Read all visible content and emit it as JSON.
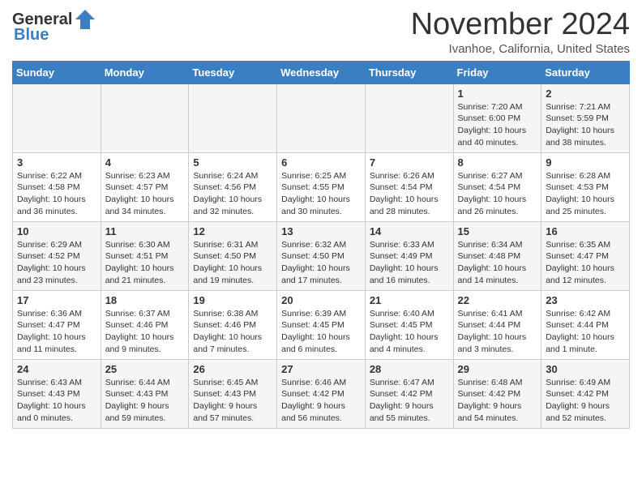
{
  "header": {
    "logo_general": "General",
    "logo_blue": "Blue",
    "month_title": "November 2024",
    "location": "Ivanhoe, California, United States"
  },
  "days_of_week": [
    "Sunday",
    "Monday",
    "Tuesday",
    "Wednesday",
    "Thursday",
    "Friday",
    "Saturday"
  ],
  "weeks": [
    [
      {
        "day": "",
        "detail": ""
      },
      {
        "day": "",
        "detail": ""
      },
      {
        "day": "",
        "detail": ""
      },
      {
        "day": "",
        "detail": ""
      },
      {
        "day": "",
        "detail": ""
      },
      {
        "day": "1",
        "detail": "Sunrise: 7:20 AM\nSunset: 6:00 PM\nDaylight: 10 hours\nand 40 minutes."
      },
      {
        "day": "2",
        "detail": "Sunrise: 7:21 AM\nSunset: 5:59 PM\nDaylight: 10 hours\nand 38 minutes."
      }
    ],
    [
      {
        "day": "3",
        "detail": "Sunrise: 6:22 AM\nSunset: 4:58 PM\nDaylight: 10 hours\nand 36 minutes."
      },
      {
        "day": "4",
        "detail": "Sunrise: 6:23 AM\nSunset: 4:57 PM\nDaylight: 10 hours\nand 34 minutes."
      },
      {
        "day": "5",
        "detail": "Sunrise: 6:24 AM\nSunset: 4:56 PM\nDaylight: 10 hours\nand 32 minutes."
      },
      {
        "day": "6",
        "detail": "Sunrise: 6:25 AM\nSunset: 4:55 PM\nDaylight: 10 hours\nand 30 minutes."
      },
      {
        "day": "7",
        "detail": "Sunrise: 6:26 AM\nSunset: 4:54 PM\nDaylight: 10 hours\nand 28 minutes."
      },
      {
        "day": "8",
        "detail": "Sunrise: 6:27 AM\nSunset: 4:54 PM\nDaylight: 10 hours\nand 26 minutes."
      },
      {
        "day": "9",
        "detail": "Sunrise: 6:28 AM\nSunset: 4:53 PM\nDaylight: 10 hours\nand 25 minutes."
      }
    ],
    [
      {
        "day": "10",
        "detail": "Sunrise: 6:29 AM\nSunset: 4:52 PM\nDaylight: 10 hours\nand 23 minutes."
      },
      {
        "day": "11",
        "detail": "Sunrise: 6:30 AM\nSunset: 4:51 PM\nDaylight: 10 hours\nand 21 minutes."
      },
      {
        "day": "12",
        "detail": "Sunrise: 6:31 AM\nSunset: 4:50 PM\nDaylight: 10 hours\nand 19 minutes."
      },
      {
        "day": "13",
        "detail": "Sunrise: 6:32 AM\nSunset: 4:50 PM\nDaylight: 10 hours\nand 17 minutes."
      },
      {
        "day": "14",
        "detail": "Sunrise: 6:33 AM\nSunset: 4:49 PM\nDaylight: 10 hours\nand 16 minutes."
      },
      {
        "day": "15",
        "detail": "Sunrise: 6:34 AM\nSunset: 4:48 PM\nDaylight: 10 hours\nand 14 minutes."
      },
      {
        "day": "16",
        "detail": "Sunrise: 6:35 AM\nSunset: 4:47 PM\nDaylight: 10 hours\nand 12 minutes."
      }
    ],
    [
      {
        "day": "17",
        "detail": "Sunrise: 6:36 AM\nSunset: 4:47 PM\nDaylight: 10 hours\nand 11 minutes."
      },
      {
        "day": "18",
        "detail": "Sunrise: 6:37 AM\nSunset: 4:46 PM\nDaylight: 10 hours\nand 9 minutes."
      },
      {
        "day": "19",
        "detail": "Sunrise: 6:38 AM\nSunset: 4:46 PM\nDaylight: 10 hours\nand 7 minutes."
      },
      {
        "day": "20",
        "detail": "Sunrise: 6:39 AM\nSunset: 4:45 PM\nDaylight: 10 hours\nand 6 minutes."
      },
      {
        "day": "21",
        "detail": "Sunrise: 6:40 AM\nSunset: 4:45 PM\nDaylight: 10 hours\nand 4 minutes."
      },
      {
        "day": "22",
        "detail": "Sunrise: 6:41 AM\nSunset: 4:44 PM\nDaylight: 10 hours\nand 3 minutes."
      },
      {
        "day": "23",
        "detail": "Sunrise: 6:42 AM\nSunset: 4:44 PM\nDaylight: 10 hours\nand 1 minute."
      }
    ],
    [
      {
        "day": "24",
        "detail": "Sunrise: 6:43 AM\nSunset: 4:43 PM\nDaylight: 10 hours\nand 0 minutes."
      },
      {
        "day": "25",
        "detail": "Sunrise: 6:44 AM\nSunset: 4:43 PM\nDaylight: 9 hours\nand 59 minutes."
      },
      {
        "day": "26",
        "detail": "Sunrise: 6:45 AM\nSunset: 4:43 PM\nDaylight: 9 hours\nand 57 minutes."
      },
      {
        "day": "27",
        "detail": "Sunrise: 6:46 AM\nSunset: 4:42 PM\nDaylight: 9 hours\nand 56 minutes."
      },
      {
        "day": "28",
        "detail": "Sunrise: 6:47 AM\nSunset: 4:42 PM\nDaylight: 9 hours\nand 55 minutes."
      },
      {
        "day": "29",
        "detail": "Sunrise: 6:48 AM\nSunset: 4:42 PM\nDaylight: 9 hours\nand 54 minutes."
      },
      {
        "day": "30",
        "detail": "Sunrise: 6:49 AM\nSunset: 4:42 PM\nDaylight: 9 hours\nand 52 minutes."
      }
    ]
  ]
}
